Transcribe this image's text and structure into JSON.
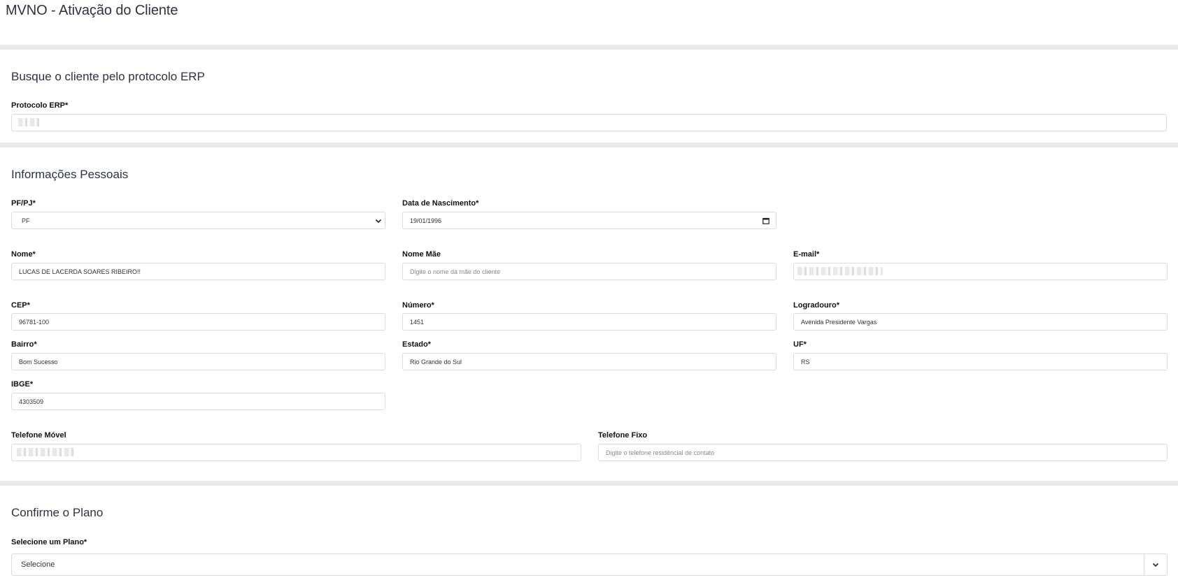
{
  "page": {
    "title": "MVNO - Ativação do Cliente"
  },
  "search_section": {
    "title": "Busque o cliente pelo protocolo ERP",
    "protocolo_label": "Protocolo ERP*",
    "protocolo_value": ""
  },
  "personal_section": {
    "title": "Informações Pessoais",
    "pfpj_label": "PF/PJ*",
    "pfpj_selected": "PF",
    "nascimento_label": "Data de Nascimento*",
    "nascimento_value": "19/01/1996",
    "nome_label": "Nome*",
    "nome_value": "LUCAS DE LACERDA SOARES RIBEIRO!!",
    "nome_mae_label": "Nome Mãe",
    "nome_mae_placeholder": "Digite o nome da mãe do cliente",
    "email_label": "E-mail*",
    "cep_label": "CEP*",
    "cep_value": "96781-100",
    "numero_label": "Número*",
    "numero_value": "1451",
    "logradouro_label": "Logradouro*",
    "logradouro_value": "Avenida Presidente Vargas",
    "bairro_label": "Bairro*",
    "bairro_value": "Bom Sucesso",
    "estado_label": "Estado*",
    "estado_value": "Rio Grande do Sul",
    "uf_label": "UF*",
    "uf_value": "RS",
    "ibge_label": "IBGE*",
    "ibge_value": "4303509",
    "tel_movel_label": "Telefone Móvel",
    "tel_fixo_label": "Telefone Fixo",
    "tel_fixo_placeholder": "Digite o telefone residêncial de contato"
  },
  "plan_section": {
    "title": "Confirme o Plano",
    "plano_label": "Selecione um Plano*",
    "plano_selected": "Selecione"
  },
  "colors": {
    "divider": "#e9e9e9",
    "border": "#dcdcdc",
    "title": "#2b3440"
  }
}
